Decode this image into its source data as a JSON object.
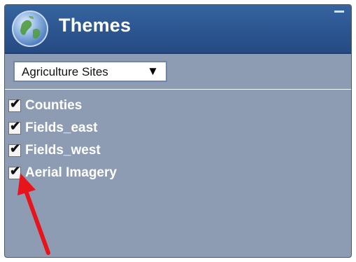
{
  "panel": {
    "title": "Themes",
    "header_icon": "globe-icon",
    "minimize_icon": "minimize-icon"
  },
  "theme_select": {
    "selected": "Agriculture Sites",
    "arrow_glyph": "▼"
  },
  "layers": [
    {
      "label": "Counties",
      "checked": true,
      "check_glyph": "✔"
    },
    {
      "label": "Fields_east",
      "checked": true,
      "check_glyph": "✔"
    },
    {
      "label": "Fields_west",
      "checked": true,
      "check_glyph": "✔"
    },
    {
      "label": "Aerial Imagery",
      "checked": true,
      "check_glyph": "✔"
    }
  ],
  "annotation": {
    "type": "red-arrow",
    "color": "#e8141b",
    "points_to": "Aerial Imagery checkbox"
  },
  "colors": {
    "header": "#2c5590",
    "panel_body": "#8d9cb3",
    "label_text": "#ffffff"
  }
}
